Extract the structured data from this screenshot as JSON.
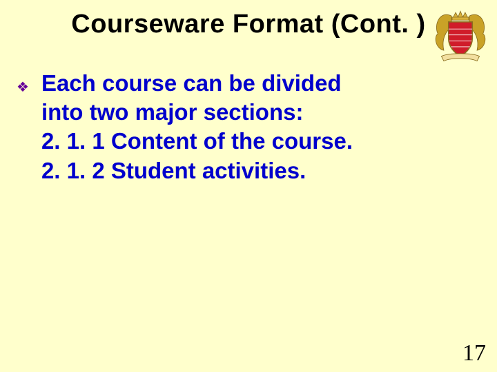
{
  "title": "Courseware Format (Cont. )",
  "bullet_glyph": "❖",
  "body": {
    "line1": "Each course can be divided",
    "line2": "into two major sections:",
    "line3": "2. 1. 1 Content of the course.",
    "line4": "2. 1. 2 Student activities."
  },
  "page_number": "17",
  "crest": {
    "shield_color": "#d01c2a",
    "shield_stroke": "#b5891f",
    "mantling_color": "#c9a227",
    "banner_color": "#f2dfa0",
    "crown_color": "#d9b23a"
  }
}
